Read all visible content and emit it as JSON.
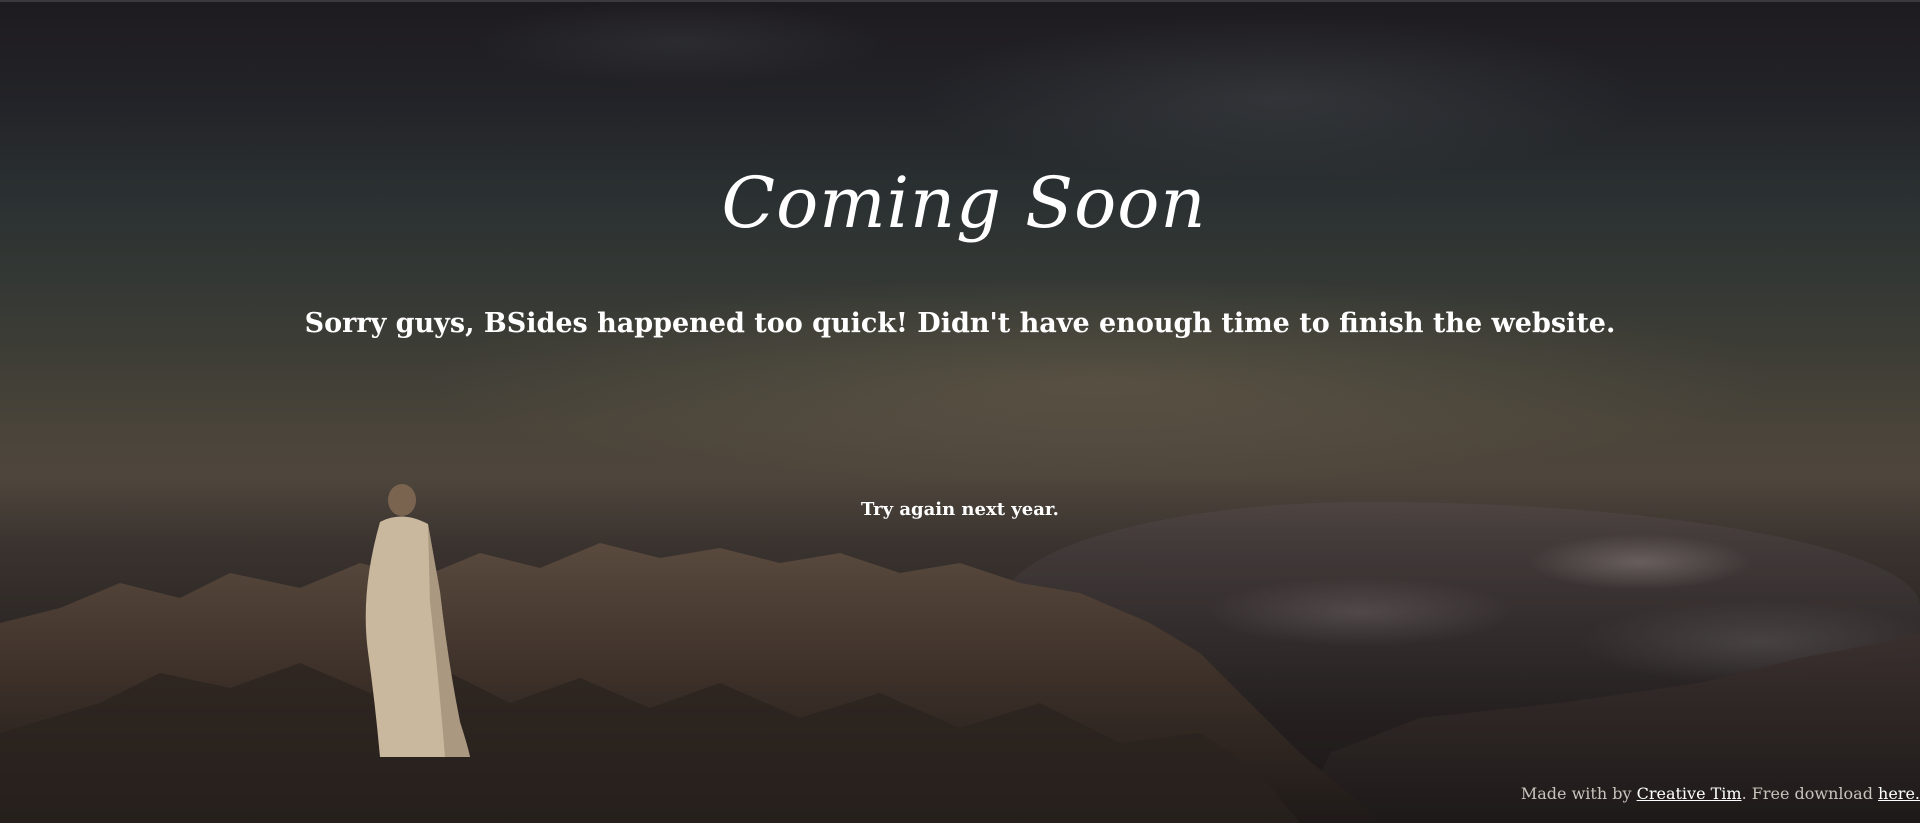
{
  "hero": {
    "title": "Coming Soon",
    "subtitle": "Sorry guys, BSides happened too quick! Didn't have enough time to finish the website.",
    "note": "Try again next year."
  },
  "footer": {
    "prefix": "Made with by ",
    "author_link": "Creative Tim",
    "middle": ". Free download ",
    "download_link": "here."
  },
  "colors": {
    "text": "#ffffff",
    "footer_text": "#c9c3bd",
    "sky_top": "#1e1b20",
    "horizon": "#4e463c",
    "ground": "#1c1817"
  }
}
